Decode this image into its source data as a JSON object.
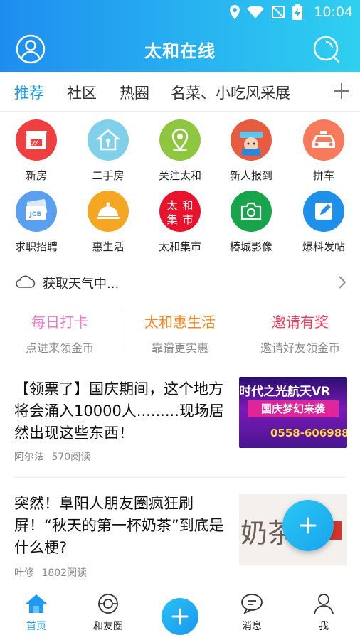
{
  "status_bar": {
    "time": "10:04"
  },
  "header": {
    "title": "太和在线"
  },
  "tabs": {
    "items": [
      {
        "label": "推荐",
        "active": true
      },
      {
        "label": "社区"
      },
      {
        "label": "热圈"
      },
      {
        "label": "名菜、小吃风采展"
      }
    ]
  },
  "quick_grid": [
    {
      "label": "新房",
      "icon": "store-icon",
      "color": "#ef3f3f"
    },
    {
      "label": "二手房",
      "icon": "house-icon",
      "color": "#7fd0e8"
    },
    {
      "label": "关注太和",
      "icon": "location-icon",
      "color": "#8ec63f"
    },
    {
      "label": "新人报到",
      "icon": "newcomer-icon",
      "color": "#e75b3e"
    },
    {
      "label": "拼车",
      "icon": "taxi-icon",
      "color": "#f77a5a"
    },
    {
      "label": "求职招聘",
      "icon": "jcb-card-icon",
      "color": "#5b9ff0"
    },
    {
      "label": "惠生活",
      "icon": "dish-cover-icon",
      "color": "#f5a623"
    },
    {
      "label": "太和集市",
      "icon": "market-seal-icon",
      "color": "#e8132c",
      "seal_text": [
        "太",
        "和",
        "集",
        "市"
      ]
    },
    {
      "label": "椿城影像",
      "icon": "camera-icon",
      "color": "#17a44a"
    },
    {
      "label": "爆料发帖",
      "icon": "edit-icon",
      "color": "#1e90ea"
    }
  ],
  "weather": {
    "text": "获取天气中..."
  },
  "promos": [
    {
      "title": "每日打卡",
      "subtitle": "点进来领金币",
      "color": "#f07ac8"
    },
    {
      "title": "太和惠生活",
      "subtitle": "靠谱更实惠",
      "color": "#f5891f"
    },
    {
      "title": "邀请有奖",
      "subtitle": "邀请好友领金币",
      "color": "#f23b5b"
    }
  ],
  "news": [
    {
      "title": "【领票了】国庆期间，这个地方将会涌入10000人.........现场居然出现这些东西！",
      "author": "阿尔法",
      "reads": "570阅读",
      "thumb": {
        "line1": "时代之光航天VR",
        "line2": "国庆梦幻来袭",
        "line3": "0558-606988"
      }
    },
    {
      "title": "突然！阜阳人朋友圈疯狂刷屏！“秋天的第一杯奶茶”到底是什么梗?",
      "author": "叶修",
      "reads": "1802阅读",
      "thumb": {
        "text": "奶茶"
      }
    }
  ],
  "bottom_nav": [
    {
      "label": "首页",
      "icon": "home-icon",
      "active": true
    },
    {
      "label": "和友圈",
      "icon": "circle-icon"
    },
    {
      "label": "消息",
      "icon": "message-icon"
    },
    {
      "label": "我",
      "icon": "user-icon"
    }
  ]
}
